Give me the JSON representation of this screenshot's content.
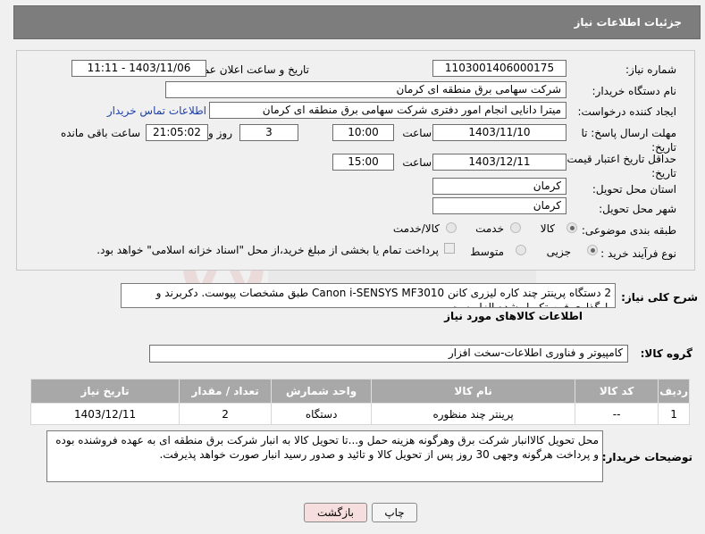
{
  "header": {
    "title": "جزئیات اطلاعات نیاز"
  },
  "form": {
    "need_number_label": "شماره نیاز:",
    "need_number": "1103001406000175",
    "announce_label": "تاریخ و ساعت اعلان عمومی:",
    "announce_value": "1403/11/06 - 11:11",
    "buyer_label": "نام دستگاه خریدار:",
    "buyer_value": "شرکت سهامی برق منطقه ای کرمان",
    "creator_label": "ایجاد کننده درخواست:",
    "creator_value": "میترا دانایی انجام امور دفتری شرکت سهامی برق منطقه ای کرمان",
    "contact_link": "اطلاعات تماس خریدار",
    "deadline_label": "مهلت ارسال پاسخ: تا تاریخ:",
    "deadline_date": "1403/11/10",
    "time_label": "ساعت",
    "deadline_time": "10:00",
    "days_value": "3",
    "days_label": "روز و",
    "remaining_time": "21:05:02",
    "remaining_label": "ساعت باقی مانده",
    "validity_label": "حداقل تاریخ اعتبار قیمت: تا تاریخ:",
    "validity_date": "1403/12/11",
    "validity_time": "15:00",
    "province_label": "استان محل تحویل:",
    "province_value": "کرمان",
    "city_label": "شهر محل تحویل:",
    "city_value": "کرمان",
    "category_label": "طبقه بندی موضوعی:",
    "category_options": [
      "کالا",
      "خدمت",
      "کالا/خدمت"
    ],
    "category_selected": "کالا",
    "process_label": "نوع فرآیند خرید :",
    "process_options": [
      "جزیی",
      "متوسط"
    ],
    "process_selected": "جزیی",
    "payment_note": "پرداخت تمام یا بخشی از مبلغ خرید،از محل \"اسناد خزانه اسلامی\" خواهد بود."
  },
  "description": {
    "label": "شرح کلی نیاز:",
    "text": "2 دستگاه پرینتر چند کاره لیزری کانن Canon i-SENSYS MF3010 طبق مشخصات پیوست. دکربرند و بارگذاری فرم تکمیل شده الزامیست."
  },
  "goods": {
    "section_title": "اطلاعات کالاهای مورد نیاز",
    "group_label": "گروه کالا:",
    "group_value": "کامپیوتر و فناوری اطلاعات-سخت افزار",
    "columns": [
      "ردیف",
      "کد کالا",
      "نام کالا",
      "واحد شمارش",
      "تعداد / مقدار",
      "تاریخ نیاز"
    ],
    "rows": [
      {
        "row": "1",
        "code": "--",
        "name": "پرینتر چند منظوره",
        "unit": "دستگاه",
        "qty": "2",
        "date": "1403/12/11"
      }
    ]
  },
  "buyer_notes": {
    "label": "توضیحات خریدار:",
    "text": "محل تحویل کالاانبار شرکت برق وهرگونه هزینه حمل و...تا تحویل کالا به انبار شرکت برق منطقه ای به عهده فروشنده بوده و پرداخت هرگونه وجهی 30 روز پس از تحویل کالا و تائید و صدور رسید انبار صورت خواهد پذیرفت."
  },
  "buttons": {
    "print": "چاپ",
    "back": "بازگشت"
  },
  "colors": {
    "header_bg": "#7d7d7d",
    "table_header_bg": "#a8a8a8",
    "link": "#1f3fa8",
    "back_button_bg": "#f6dede"
  }
}
